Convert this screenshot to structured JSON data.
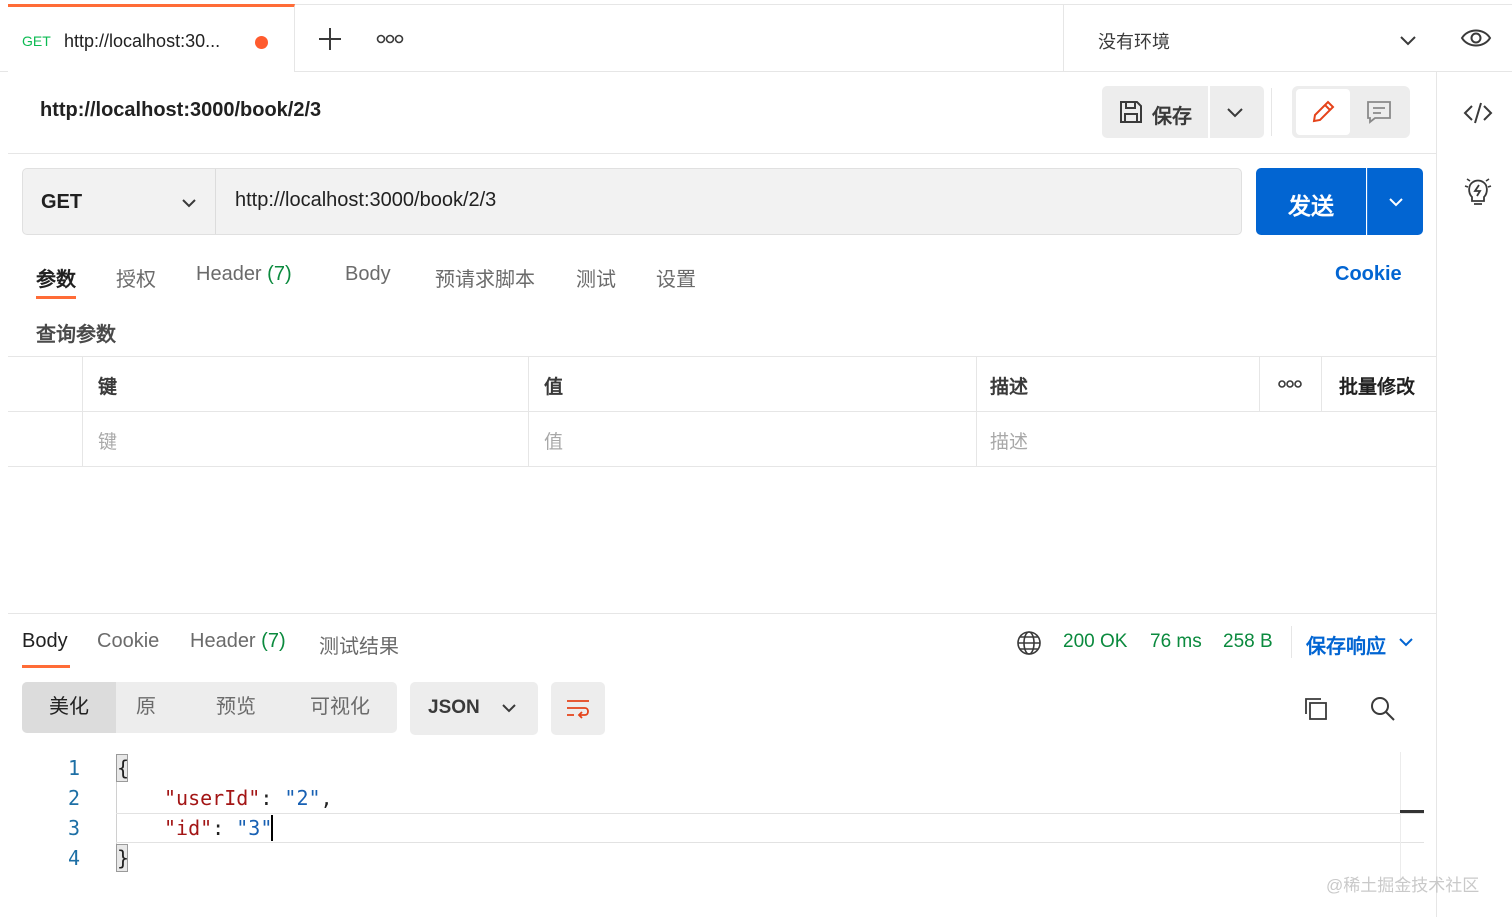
{
  "tab": {
    "method": "GET",
    "title": "http://localhost:30...",
    "unsaved_color": "#ff5b2e"
  },
  "environment": {
    "label": "没有环境"
  },
  "request": {
    "name": "http://localhost:3000/book/2/3",
    "method": "GET",
    "url": "http://localhost:3000/book/2/3"
  },
  "toolbar": {
    "save_label": "保存",
    "send_label": "发送"
  },
  "request_tabs": [
    {
      "label": "参数"
    },
    {
      "label": "授权"
    },
    {
      "label": "Header",
      "count": "(7)"
    },
    {
      "label": "Body"
    },
    {
      "label": "预请求脚本"
    },
    {
      "label": "测试"
    },
    {
      "label": "设置"
    }
  ],
  "cookie_link": "Cookie",
  "params": {
    "title": "查询参数",
    "headers": {
      "key": "键",
      "value": "值",
      "description": "描述",
      "bulk_edit": "批量修改"
    },
    "placeholders": {
      "key": "键",
      "value": "值",
      "description": "描述"
    }
  },
  "response": {
    "tabs": [
      {
        "label": "Body"
      },
      {
        "label": "Cookie"
      },
      {
        "label": "Header",
        "count": "(7)"
      },
      {
        "label": "测试结果"
      }
    ],
    "status": "200 OK",
    "time": "76 ms",
    "size": "258 B",
    "save_label": "保存响应",
    "view_modes": [
      "美化",
      "原",
      "预览",
      "可视化"
    ],
    "format": "JSON",
    "code_lines": [
      "1",
      "2",
      "3",
      "4"
    ],
    "code": {
      "open": "{",
      "k1": "\"userId\"",
      "v1": "\"2\"",
      "k2": "\"id\"",
      "v2": "\"3\"",
      "close": "}"
    }
  },
  "colors": {
    "accent": "#ff6c37",
    "primary": "#0265d2",
    "success": "#0b8a3e"
  },
  "watermark": "@稀土掘金技术社区"
}
